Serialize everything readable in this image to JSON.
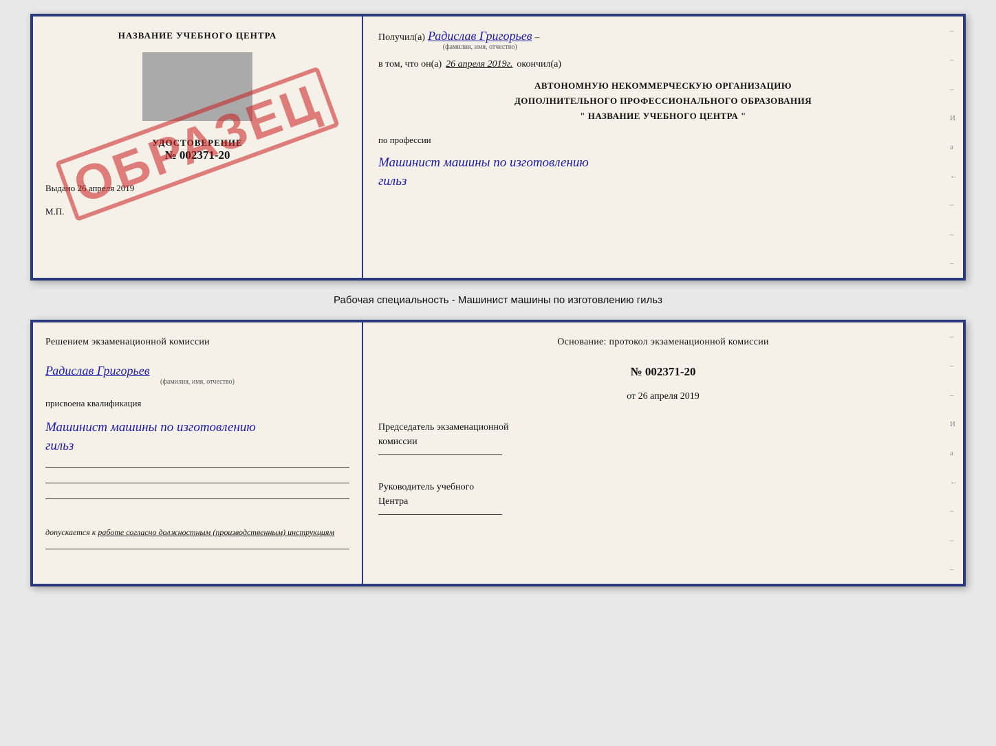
{
  "top_doc": {
    "left": {
      "center_title": "НАЗВАНИЕ УЧЕБНОГО ЦЕНТРА",
      "udostoverenie_label": "УДОСТОВЕРЕНИЕ",
      "udostoverenie_number": "№ 002371-20",
      "vydano_label": "Выдано",
      "vydano_date": "26 апреля 2019",
      "mp_label": "М.П.",
      "obrazec": "ОБРАЗЕЦ"
    },
    "right": {
      "poluchil_label": "Получил(а)",
      "poluchil_name": "Радислав Григорьев",
      "fam_label": "(фамилия, имя, отчество)",
      "dash1": "–",
      "vtom_label": "в том, что он(а)",
      "vtom_date": "26 апреля 2019г.",
      "okonchil_label": "окончил(а)",
      "org_line1": "АВТОНОМНУЮ НЕКОММЕРЧЕСКУЮ ОРГАНИЗАЦИЮ",
      "org_line2": "ДОПОЛНИТЕЛЬНОГО ПРОФЕССИОНАЛЬНОГО ОБРАЗОВАНИЯ",
      "org_line3": "\"  НАЗВАНИЕ УЧЕБНОГО ЦЕНТРА  \"",
      "po_professii_label": "по профессии",
      "profession_text": "Машинист машины по изготовлению",
      "profession_text2": "гильз",
      "side_marks": [
        "–",
        "–",
        "–",
        "И",
        "а",
        "←",
        "–",
        "–",
        "–"
      ]
    }
  },
  "working_specialty": {
    "label": "Рабочая специальность - Машинист машины по изготовлению гильз"
  },
  "bottom_doc": {
    "left": {
      "resheniem_text": "Решением  экзаменационной  комиссии",
      "person_name": "Радислав Григорьев",
      "fam_label": "(фамилия, имя, отчество)",
      "prisvoena_label": "присвоена квалификация",
      "qualification_text": "Машинист машины по изготовлению",
      "qualification_text2": "гильз",
      "dopusk_prefix": "допускается к",
      "dopusk_text": "работе согласно должностным (производственным) инструкциям"
    },
    "right": {
      "osnovanie_label": "Основание: протокол экзаменационной  комиссии",
      "protocol_number": "№  002371-20",
      "ot_label": "от",
      "ot_date": "26 апреля 2019",
      "predsedatel_line1": "Председатель экзаменационной",
      "predsedatel_line2": "комиссии",
      "rukovoditel_line1": "Руководитель учебного",
      "rukovoditel_line2": "Центра",
      "side_marks": [
        "–",
        "–",
        "–",
        "И",
        "а",
        "←",
        "–",
        "–",
        "–"
      ]
    }
  }
}
